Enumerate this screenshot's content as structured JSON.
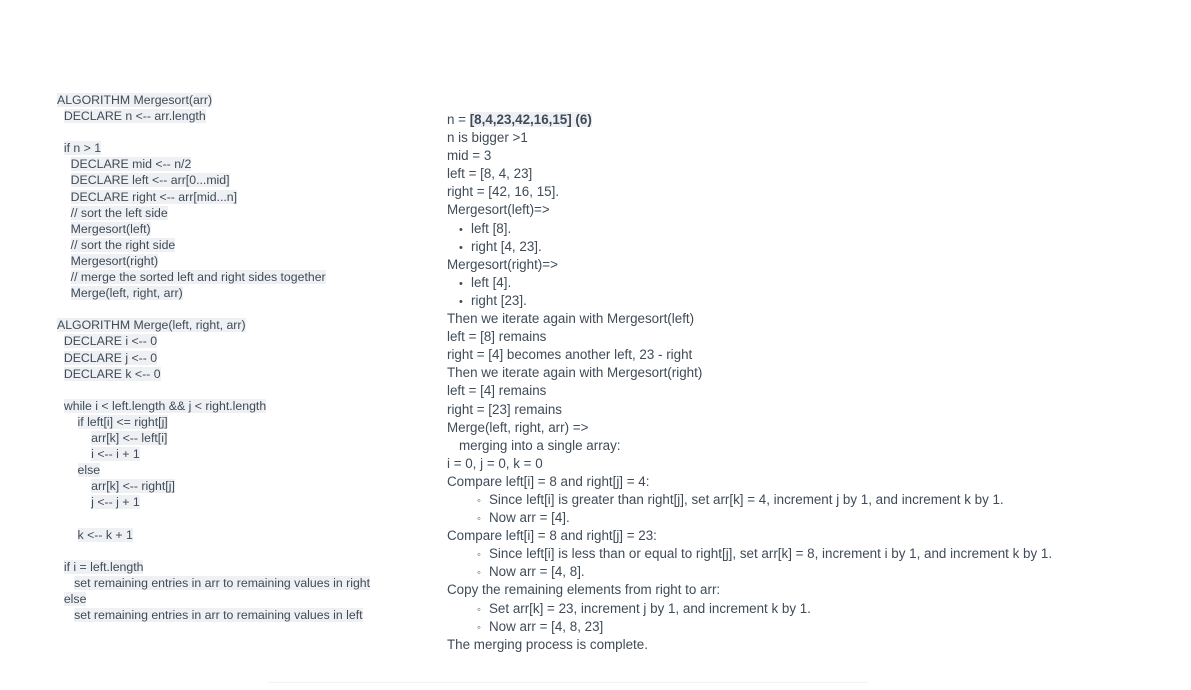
{
  "code_lines": [
    "ALGORITHM Mergesort(arr)",
    "  DECLARE n <-- arr.length",
    "",
    "  if n > 1",
    "    DECLARE mid <-- n/2",
    "    DECLARE left <-- arr[0...mid]",
    "    DECLARE right <-- arr[mid...n]",
    "    // sort the left side",
    "    Mergesort(left)",
    "    // sort the right side",
    "    Mergesort(right)",
    "    // merge the sorted left and right sides together",
    "    Merge(left, right, arr)",
    "",
    "ALGORITHM Merge(left, right, arr)",
    "  DECLARE i <-- 0",
    "  DECLARE j <-- 0",
    "  DECLARE k <-- 0",
    "",
    "  while i < left.length && j < right.length",
    "      if left[i] <= right[j]",
    "          arr[k] <-- left[i]",
    "          i <-- i + 1",
    "      else",
    "          arr[k] <-- right[j]",
    "          j <-- j + 1",
    "",
    "      k <-- k + 1",
    "",
    "  if i = left.length",
    "     set remaining entries in arr to remaining values in right",
    "  else",
    "     set remaining entries in arr to remaining values in left"
  ],
  "notes": {
    "n_prefix": "n = ",
    "n_value": "[8,4,23,42,16,15] (6)",
    "lines": [
      {
        "style": "plain",
        "text": "n is bigger >1"
      },
      {
        "style": "plain",
        "text": "mid = 3"
      },
      {
        "style": "plain",
        "text": "left = [8, 4, 23]"
      },
      {
        "style": "plain",
        "text": "right = [42, 16, 15]."
      },
      {
        "style": "plain",
        "text": "Mergesort(left)=>"
      },
      {
        "style": "b1",
        "text": "left [8]."
      },
      {
        "style": "b1",
        "text": "right [4, 23]."
      },
      {
        "style": "plain",
        "text": "Mergesort(right)=>"
      },
      {
        "style": "b1",
        "text": "left [4]."
      },
      {
        "style": "b1",
        "text": "right [23]."
      },
      {
        "style": "plain",
        "text": "Then we iterate again with Mergesort(left)"
      },
      {
        "style": "plain",
        "text": "left = [8] remains"
      },
      {
        "style": "plain",
        "text": "right = [4] becomes another left, 23 - right"
      },
      {
        "style": "plain",
        "text": "Then we iterate again with Mergesort(right)"
      },
      {
        "style": "plain",
        "text": "left = [4] remains"
      },
      {
        "style": "plain",
        "text": "right = [23] remains"
      },
      {
        "style": "plain",
        "text": "Merge(left, right, arr) =>"
      },
      {
        "style": "ind",
        "text": "merging into a single array:"
      },
      {
        "style": "plain",
        "text": "i = 0, j = 0, k = 0"
      },
      {
        "style": "plain",
        "text": "Compare left[i] = 8 and right[j] = 4:"
      },
      {
        "style": "b2",
        "text": "Since left[i] is greater than right[j], set arr[k] = 4, increment j by 1, and increment k by 1."
      },
      {
        "style": "b2",
        "text": "Now arr = [4]."
      },
      {
        "style": "plain",
        "text": "Compare left[i] = 8 and right[j] = 23:"
      },
      {
        "style": "b2",
        "text": "Since left[i] is less than or equal to right[j], set arr[k] = 8, increment i by 1, and increment k by 1."
      },
      {
        "style": "b2",
        "text": "Now arr = [4, 8]."
      },
      {
        "style": "plain",
        "text": "Copy the remaining elements from right to arr:"
      },
      {
        "style": "b2",
        "text": "Set arr[k] = 23, increment j by 1, and increment k by 1."
      },
      {
        "style": "b2",
        "text": "Now arr = [4, 8, 23]"
      },
      {
        "style": "plain",
        "text": "The merging process is complete."
      }
    ]
  }
}
